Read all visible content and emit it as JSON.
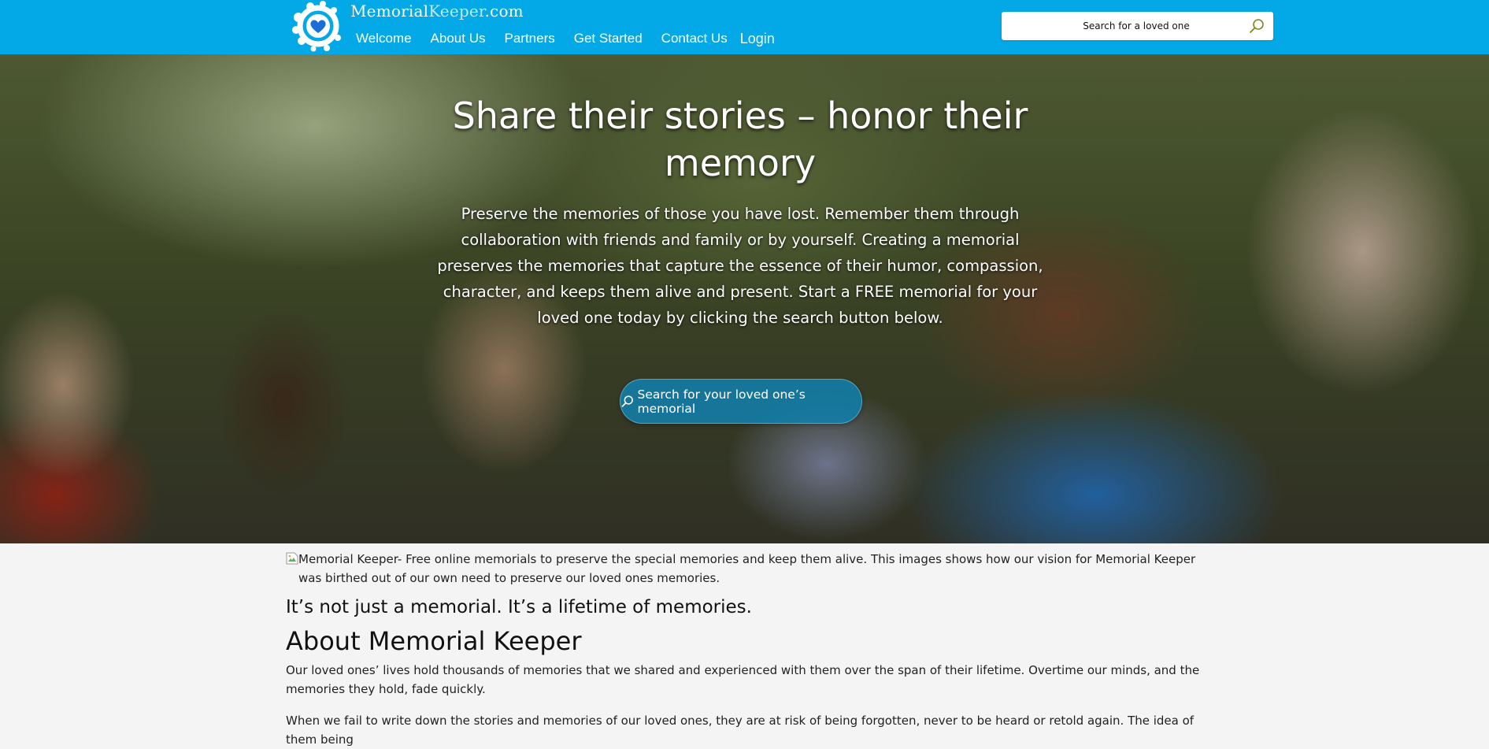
{
  "header": {
    "brand_memorial": "Memorial",
    "brand_keeper": "Keeper",
    "brand_tld": ".com",
    "logo_icon": "heart-circle-logo",
    "bg_color": "#03a9e6",
    "nav": [
      {
        "label": "Welcome"
      },
      {
        "label": "About Us"
      },
      {
        "label": "Partners"
      },
      {
        "label": "Get Started"
      },
      {
        "label": "Contact Us"
      },
      {
        "label": "Login"
      }
    ],
    "search": {
      "placeholder": "Search for a loved one",
      "icon": "search-icon"
    }
  },
  "hero": {
    "title": "Share their stories – honor their memory",
    "text": "Preserve the memories of those you have lost. Remember them through collaboration with friends and family or by yourself. Creating a memorial preserves the memories that capture the essence of their humor, compassion, character, and keeps them alive and present. Start a FREE memorial for your loved one today by clicking the search button below.",
    "button_label": "Search for your loved one’s memorial",
    "button_icon": "search-icon"
  },
  "content": {
    "image_alt": "Memorial Keeper- Free online memorials to preserve the special memories and keep them alive. This images shows how our vision for Memorial Keeper was birthed out of our own need to preserve our loved ones memories.",
    "tagline": "It’s not just a memorial. It’s a lifetime of memories.",
    "about_title": "About Memorial Keeper",
    "paragraph_1": "Our loved ones’ lives hold thousands of memories that we shared and experienced with them over the span of their lifetime. Overtime our minds, and the memories they hold, fade quickly.",
    "paragraph_2": "When we fail to write down the stories and memories of our loved ones, they are at risk of being forgotten, never to be heard or retold again. The idea of them being"
  }
}
